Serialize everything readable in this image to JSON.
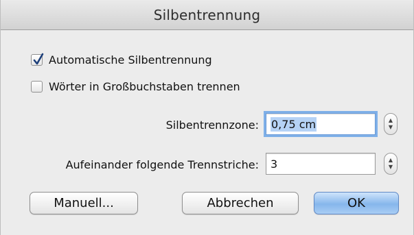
{
  "dialog": {
    "title": "Silbentrennung"
  },
  "options": {
    "auto_hyphenation": {
      "label": "Automatische Silbentrennung",
      "checked": true
    },
    "caps_hyphenation": {
      "label": "Wörter in Großbuchstaben trennen",
      "checked": false
    }
  },
  "zone": {
    "label": "Silbentrennzone:",
    "value": "0,75 cm"
  },
  "consecutive": {
    "label": "Aufeinander folgende Trennstriche:",
    "value": "3"
  },
  "buttons": {
    "manual": "Manuell...",
    "cancel": "Abbrechen",
    "ok": "OK"
  },
  "colors": {
    "accent": "#3c6fc6",
    "focus_ring": "#7fb0e8"
  }
}
